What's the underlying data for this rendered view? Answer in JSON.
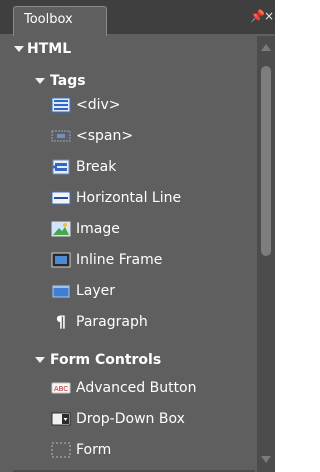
{
  "panel": {
    "tab_title": "Toolbox",
    "pin_icon": "pin-icon",
    "close_icon": "close-icon"
  },
  "sections": {
    "html": "HTML",
    "tags": "Tags",
    "form_controls": "Form Controls"
  },
  "tags": [
    {
      "label": "<div>",
      "icon": "div-tag-icon"
    },
    {
      "label": "<span>",
      "icon": "span-tag-icon"
    },
    {
      "label": "Break",
      "icon": "break-icon"
    },
    {
      "label": "Horizontal Line",
      "icon": "horizontal-line-icon"
    },
    {
      "label": "Image",
      "icon": "image-icon"
    },
    {
      "label": "Inline Frame",
      "icon": "inline-frame-icon"
    },
    {
      "label": "Layer",
      "icon": "layer-icon"
    },
    {
      "label": "Paragraph",
      "icon": "paragraph-icon"
    }
  ],
  "form_controls": [
    {
      "label": "Advanced Button",
      "icon": "advanced-button-icon"
    },
    {
      "label": "Drop-Down Box",
      "icon": "drop-down-box-icon"
    },
    {
      "label": "Form",
      "icon": "form-icon"
    }
  ],
  "colors": {
    "panel_bg": "#5f5f5f",
    "titlebar_bg": "#3f3f3f",
    "text": "#ffffff",
    "scrollbar": "#4c4c4c"
  }
}
